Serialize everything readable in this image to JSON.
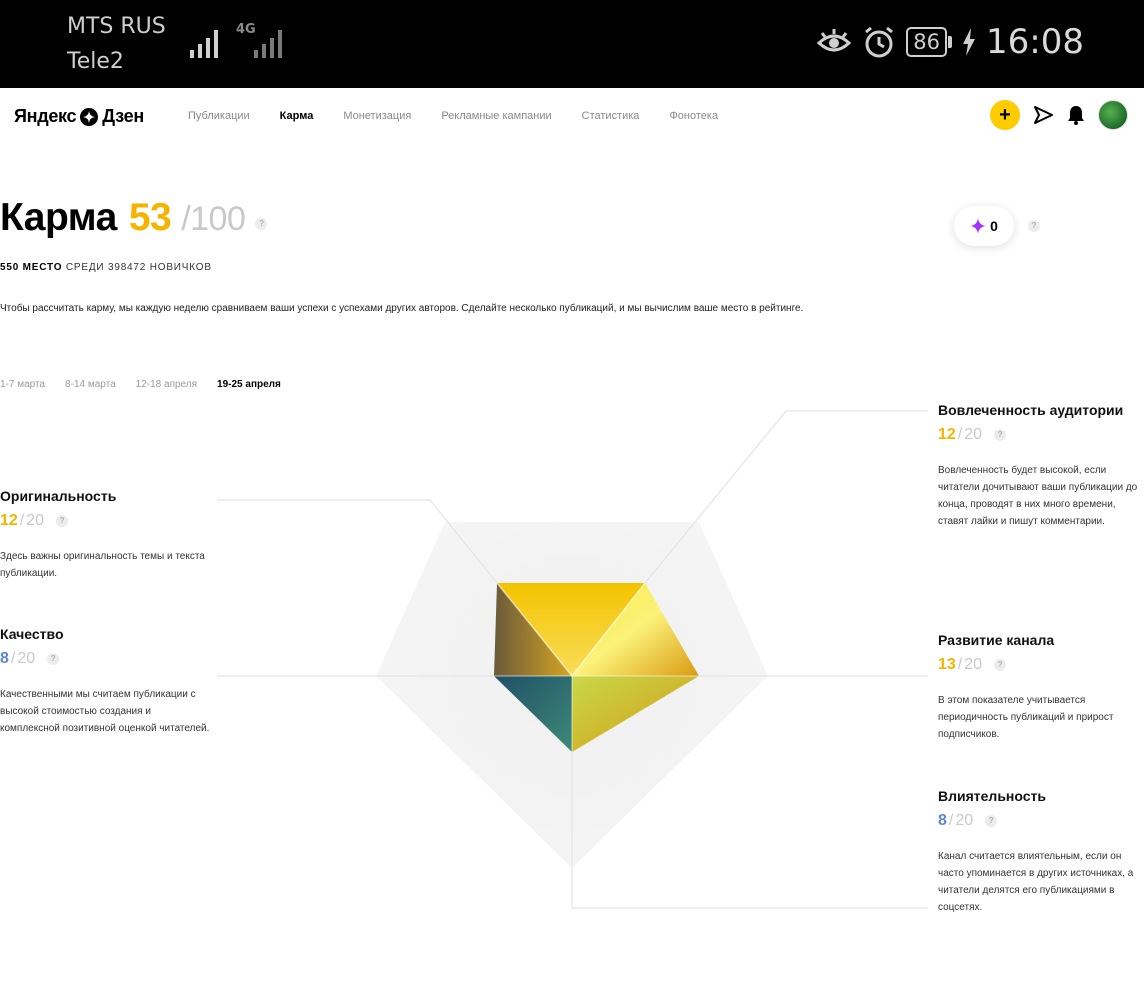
{
  "status_bar": {
    "carrier1": "MTS RUS",
    "carrier2": "Tele2",
    "network_label": "4G",
    "battery": "86",
    "time": "16:08"
  },
  "nav": {
    "logo": "Яндекс",
    "logo_part2": "Дзен",
    "links": [
      "Публикации",
      "Карма",
      "Монетизация",
      "Рекламные кампании",
      "Статистика",
      "Фонотека"
    ],
    "active_link": "Карма",
    "add_button": "+"
  },
  "karma": {
    "title": "Карма",
    "score": "53",
    "max": "/100",
    "help": "?",
    "coins": "0",
    "rank_place": "550 МЕСТО",
    "rank_rest": "СРЕДИ 398472 НОВИЧКОВ",
    "description": "Чтобы рассчитать карму, мы каждую неделю сравниваем ваши успехи с успехами других авторов. Сделайте несколько публикаций, и мы вычислим ваше место в рейтинге.",
    "weeks": [
      "1-7 марта",
      "8-14 марта",
      "12-18 апреля",
      "19-25 апреля"
    ],
    "active_week": "19-25 апреля"
  },
  "metrics": {
    "originality": {
      "title": "Оригинальность",
      "value": "12",
      "max": "20",
      "text": "Здесь важны оригинальность темы и текста публикации."
    },
    "quality": {
      "title": "Качество",
      "value": "8",
      "max": "20",
      "text": "Качественными мы считаем публикации с высокой стоимостью создания и комплексной позитивной оценкой читателей."
    },
    "engagement": {
      "title": "Вовлеченность аудитории",
      "value": "12",
      "max": "20",
      "text": "Вовлеченность будет высокой, если читатели дочитывают ваши публикации до конца, проводят в них много времени, ставят лайки и пишут комментарии."
    },
    "growth": {
      "title": "Развитие канала",
      "value": "13",
      "max": "20",
      "text": "В этом показателе учитывается периодичность публикаций и прирост подписчиков."
    },
    "influence": {
      "title": "Влиятельность",
      "value": "8",
      "max": "20",
      "text": "Канал считается влиятельным, если он часто упоминается в других источниках, а читатели делятся его публикациями в соцсетях."
    }
  },
  "colors": {
    "accent": "#f5b400",
    "blue": "#5d87d6"
  }
}
